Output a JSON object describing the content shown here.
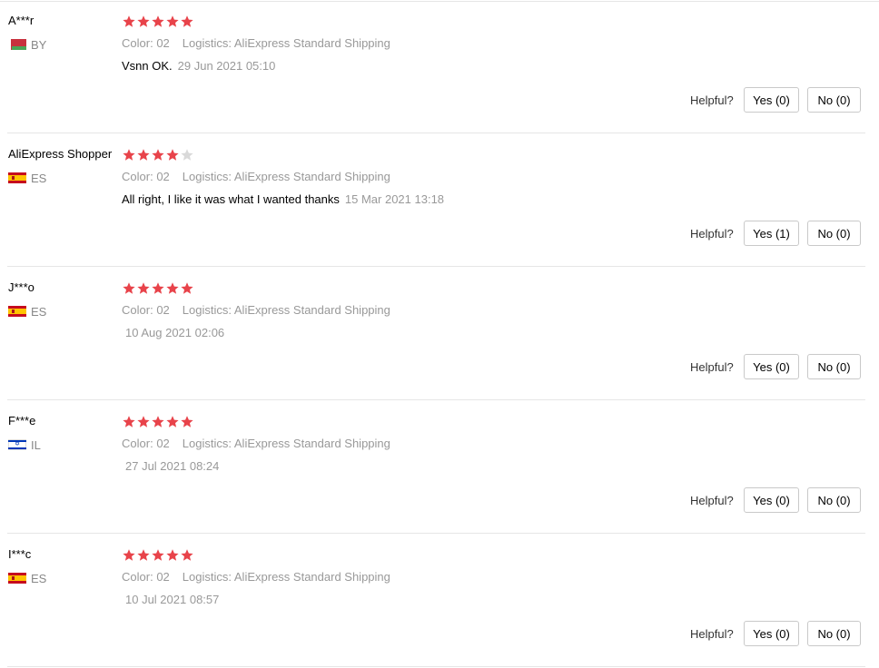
{
  "labels": {
    "color": "Color:",
    "logistics": "Logistics:",
    "helpful": "Helpful?"
  },
  "colors": {
    "star_filled": "#e8434a",
    "star_empty": "#d9d9d9"
  },
  "reviews": [
    {
      "user": "A***r",
      "country": "BY",
      "flag_icon": "belarus-flag-icon",
      "rating": 5,
      "color_value": "02",
      "logistics_value": "AliExpress Standard Shipping",
      "comment": "Vsnn OK.",
      "date": "29 Jun 2021 05:10",
      "yes": "Yes (0)",
      "no": "No (0)"
    },
    {
      "user": "AliExpress Shopper",
      "country": "ES",
      "flag_icon": "spain-flag-icon",
      "rating": 4,
      "color_value": "02",
      "logistics_value": "AliExpress Standard Shipping",
      "comment": "All right, I like it was what I wanted thanks",
      "date": "15 Mar 2021 13:18",
      "yes": "Yes (1)",
      "no": "No (0)"
    },
    {
      "user": "J***o",
      "country": "ES",
      "flag_icon": "spain-flag-icon",
      "rating": 5,
      "color_value": "02",
      "logistics_value": "AliExpress Standard Shipping",
      "comment": "",
      "date": "10 Aug 2021 02:06",
      "yes": "Yes (0)",
      "no": "No (0)"
    },
    {
      "user": "F***e",
      "country": "IL",
      "flag_icon": "israel-flag-icon",
      "rating": 5,
      "color_value": "02",
      "logistics_value": "AliExpress Standard Shipping",
      "comment": "",
      "date": "27 Jul 2021 08:24",
      "yes": "Yes (0)",
      "no": "No (0)"
    },
    {
      "user": "I***c",
      "country": "ES",
      "flag_icon": "spain-flag-icon",
      "rating": 5,
      "color_value": "02",
      "logistics_value": "AliExpress Standard Shipping",
      "comment": "",
      "date": "10 Jul 2021 08:57",
      "yes": "Yes (0)",
      "no": "No (0)"
    }
  ]
}
